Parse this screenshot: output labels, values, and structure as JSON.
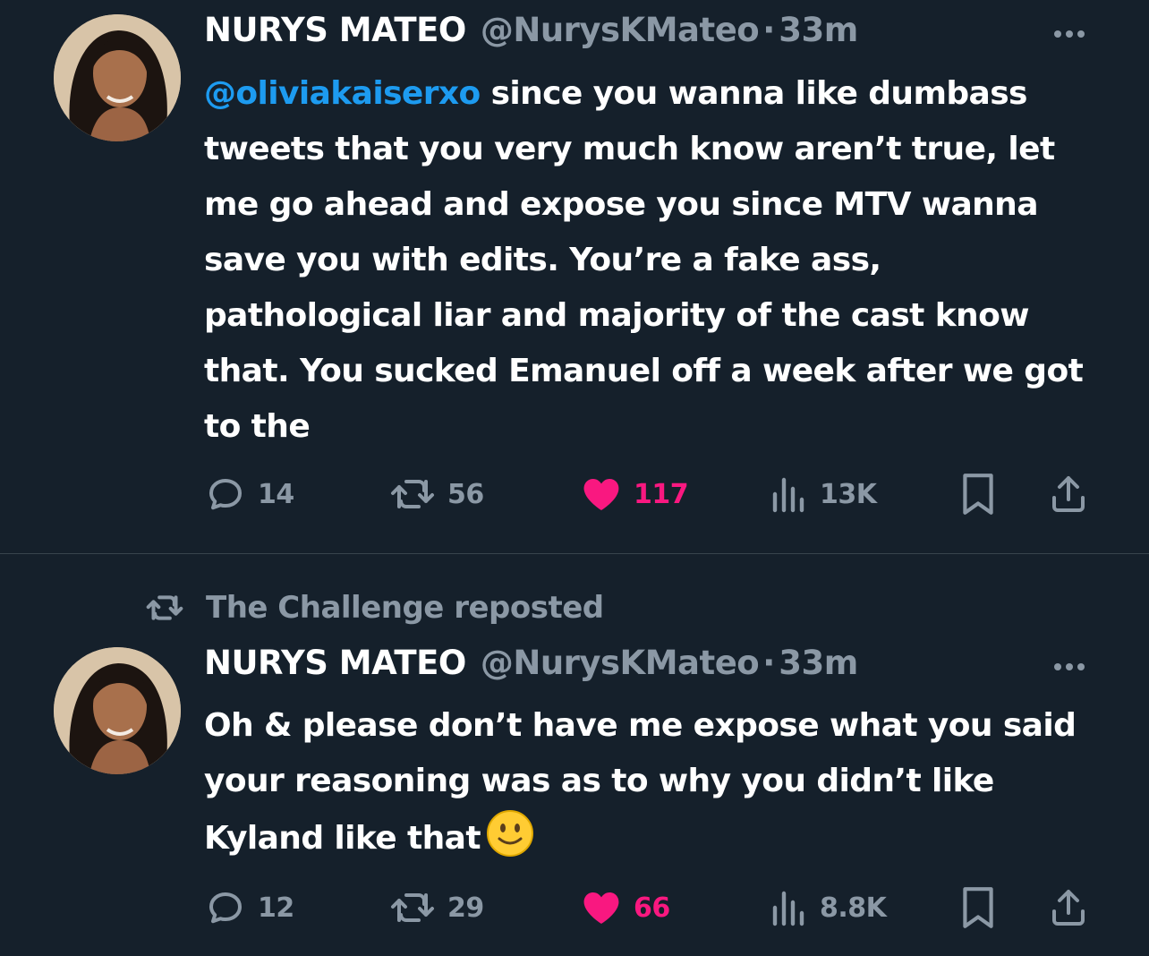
{
  "tweets": [
    {
      "author_name": "NURYS MATEO",
      "author_handle": "@NurysKMateo",
      "separator": "·",
      "time": "33m",
      "text_mention": "@oliviakaiserxo",
      "text_body": " since you wanna like dumbass tweets that you very much know aren’t true, let me go ahead and expose you since MTV wanna save you with edits. You’re a fake ass, pathological liar and majority of the cast know that. You sucked Emanuel off a week after we got to the",
      "replies": "14",
      "reposts": "56",
      "likes": "117",
      "views": "13K",
      "liked": true
    },
    {
      "reposted_by": "The Challenge reposted",
      "author_name": "NURYS MATEO",
      "author_handle": "@NurysKMateo",
      "separator": "·",
      "time": "33m",
      "text_body": "Oh & please don’t have me expose what you said your reasoning was as to why you didn’t like Kyland like that",
      "emoji": "slightly-smiling-face",
      "replies": "12",
      "reposts": "29",
      "likes": "66",
      "views": "8.8K",
      "liked": true
    }
  ],
  "colors": {
    "background": "#15202b",
    "text": "#ffffff",
    "secondary": "#8b98a5",
    "mention": "#1d9bf0",
    "like": "#f91880",
    "divider": "#38444d"
  },
  "icons": {
    "reply": "reply-icon",
    "repost": "repost-icon",
    "like": "heart-icon",
    "views": "views-icon",
    "bookmark": "bookmark-icon",
    "share": "share-icon",
    "more": "more-icon"
  }
}
